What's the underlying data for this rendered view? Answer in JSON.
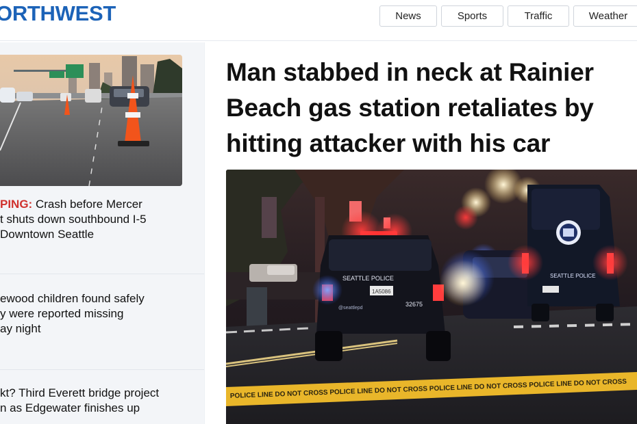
{
  "site": {
    "logo_text": "ORTHWEST"
  },
  "nav": {
    "items": [
      "News",
      "Sports",
      "Traffic",
      "Weather"
    ]
  },
  "sidebar": {
    "stories": [
      {
        "kicker": "PING:",
        "text": " Crash before Mercer\nt shuts down southbound I-5\n Downtown Seattle"
      },
      {
        "kicker": "",
        "text": "ewood children found safely\ny were reported missing\nay night"
      },
      {
        "kicker": "",
        "text": "kt? Third Everett bridge project\nn as Edgewater finishes up"
      }
    ]
  },
  "article": {
    "headline": "Man stabbed in neck at Rainier Beach gas station retaliates by hitting attacker with his car"
  },
  "hero": {
    "car_text": "SEATTLE   POLICE",
    "plate": "1A5086",
    "unit_number": "32675",
    "rear_text": "@seattlepd",
    "van_text": "SEATTLE POLICE",
    "van_door": "SEATTLE",
    "tape_text": "POLICE LINE DO NOT CROSS   POLICE LINE DO NOT CROSS   POLICE LINE DO NOT CROSS   POLICE LINE DO NOT CROSS"
  },
  "colors": {
    "brand": "#1c63b8",
    "kicker": "#d0312d",
    "tape": "#e9b62a"
  }
}
